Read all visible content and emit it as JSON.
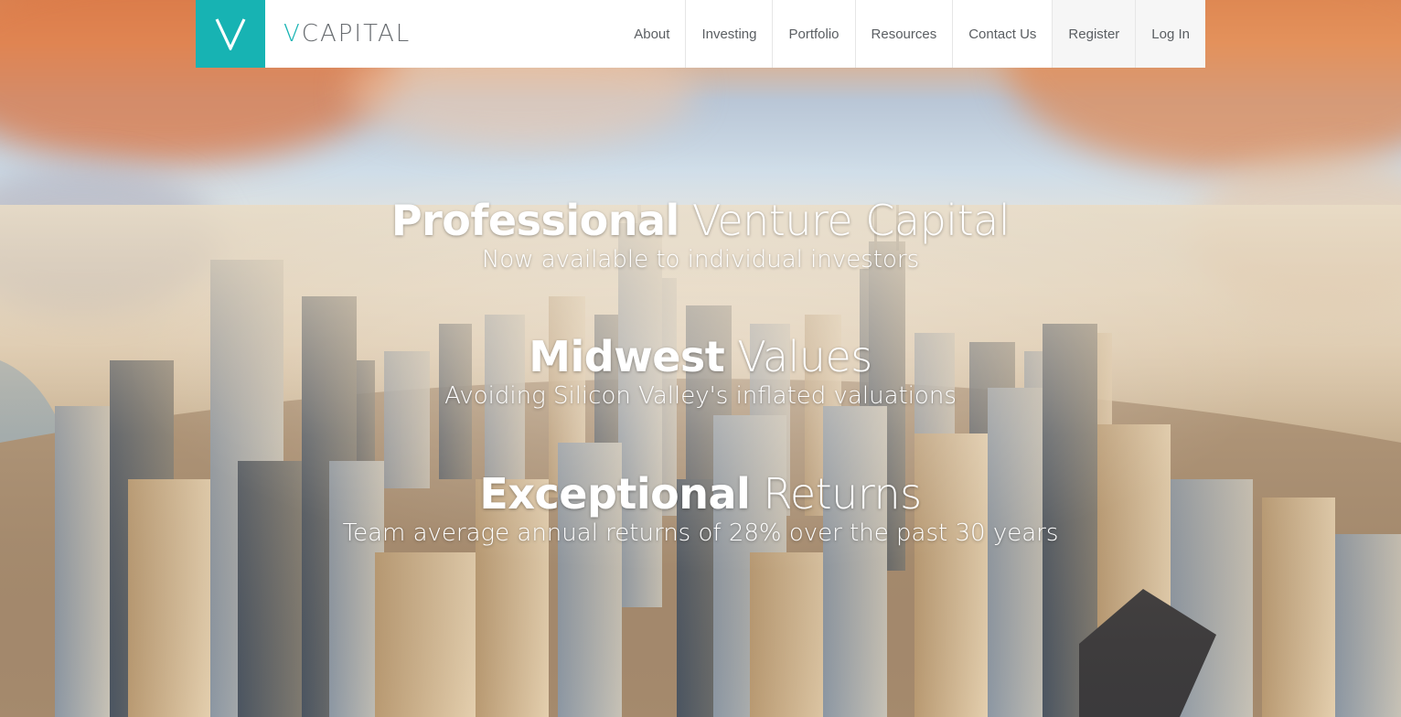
{
  "brand": {
    "logo_letter": "V",
    "name_prefix": "V",
    "name_rest": "CAPITAL",
    "accent_color": "#17b3b3"
  },
  "nav": {
    "items": [
      {
        "label": "About"
      },
      {
        "label": "Investing"
      },
      {
        "label": "Portfolio"
      },
      {
        "label": "Resources"
      },
      {
        "label": "Contact Us"
      },
      {
        "label": "Register"
      },
      {
        "label": "Log In"
      }
    ]
  },
  "hero": {
    "blocks": [
      {
        "bold": "Professional",
        "light": " Venture Capital",
        "sub": "Now available to individual investors"
      },
      {
        "bold": "Midwest",
        "light": " Values",
        "sub": "Avoiding Silicon Valley's inflated valuations"
      },
      {
        "bold": "Exceptional",
        "light": " Returns",
        "sub": "Team average annual returns of 28% over the past 30 years"
      }
    ],
    "background": "aerial city skyline photo"
  }
}
